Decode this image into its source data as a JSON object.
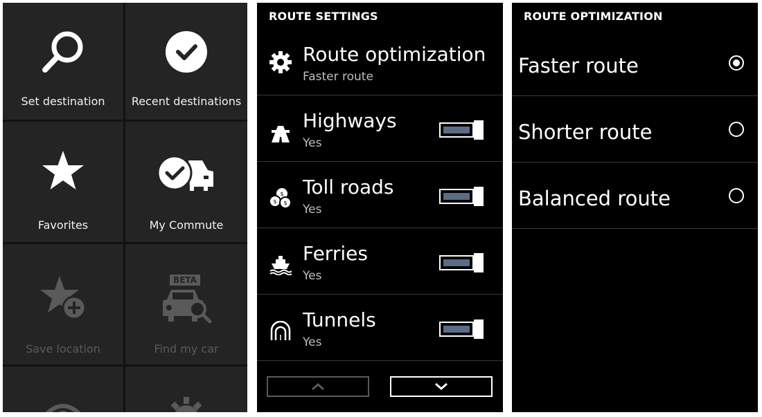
{
  "main_menu": {
    "tiles": [
      {
        "label": "Set destination",
        "icon": "search-icon",
        "enabled": true
      },
      {
        "label": "Recent destinations",
        "icon": "check-circle-icon",
        "enabled": true
      },
      {
        "label": "Favorites",
        "icon": "star-icon",
        "enabled": true
      },
      {
        "label": "My Commute",
        "icon": "commute-icon",
        "enabled": true
      },
      {
        "label": "Save location",
        "icon": "star-plus-icon",
        "enabled": false
      },
      {
        "label": "Find my car",
        "icon": "car-search-icon",
        "enabled": false,
        "badge": "BETA"
      },
      {
        "label": "",
        "icon": "eye-icon",
        "enabled": false
      },
      {
        "label": "",
        "icon": "gear-icon",
        "enabled": false
      }
    ]
  },
  "route_settings": {
    "header": "ROUTE SETTINGS",
    "rows": [
      {
        "title": "Route optimization",
        "value": "Faster route",
        "icon": "gear-icon"
      },
      {
        "title": "Highways",
        "value": "Yes",
        "icon": "highway-icon",
        "toggle_on": true
      },
      {
        "title": "Toll roads",
        "value": "Yes",
        "icon": "toll-coins-icon",
        "toggle_on": true
      },
      {
        "title": "Ferries",
        "value": "Yes",
        "icon": "ferry-icon",
        "toggle_on": true
      },
      {
        "title": "Tunnels",
        "value": "Yes",
        "icon": "tunnel-icon",
        "toggle_on": true
      }
    ],
    "nav": {
      "up_icon": "chevron-up-icon",
      "down_icon": "chevron-down-icon"
    }
  },
  "route_optimization": {
    "header": "ROUTE OPTIMIZATION",
    "options": [
      {
        "label": "Faster route",
        "selected": true
      },
      {
        "label": "Shorter route",
        "selected": false
      },
      {
        "label": "Balanced route",
        "selected": false
      }
    ]
  },
  "colors": {
    "background": "#000000",
    "tile": "#242424",
    "toggle_fill": "#5b6c86",
    "disabled": "#5a5a5a"
  }
}
